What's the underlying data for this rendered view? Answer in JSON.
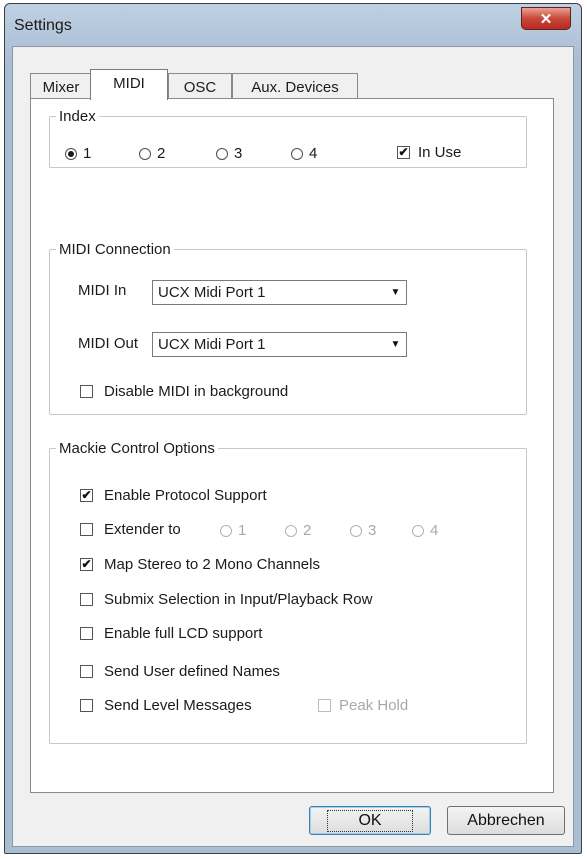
{
  "window": {
    "title": "Settings",
    "close_glyph": "✕"
  },
  "tabs": [
    {
      "label": "Mixer",
      "active": false
    },
    {
      "label": "MIDI",
      "active": true
    },
    {
      "label": "OSC",
      "active": false
    },
    {
      "label": "Aux. Devices",
      "active": false
    }
  ],
  "index": {
    "legend": "Index",
    "options": [
      "1",
      "2",
      "3",
      "4"
    ],
    "selected": "1",
    "in_use_label": "In Use",
    "in_use_checked": true
  },
  "midi_connection": {
    "legend": "MIDI Connection",
    "midi_in_label": "MIDI In",
    "midi_in_value": "UCX Midi Port 1",
    "midi_out_label": "MIDI Out",
    "midi_out_value": "UCX Midi Port 1",
    "disable_bg_label": "Disable MIDI in background",
    "disable_bg_checked": false
  },
  "mackie": {
    "legend": "Mackie Control Options",
    "enable_protocol_label": "Enable Protocol Support",
    "enable_protocol_checked": true,
    "extender_label": "Extender to",
    "extender_options": [
      "1",
      "2",
      "3",
      "4"
    ],
    "map_stereo_label": "Map Stereo to 2 Mono Channels",
    "map_stereo_checked": true,
    "submix_label": "Submix Selection in Input/Playback Row",
    "submix_checked": false,
    "lcd_label": "Enable full LCD support",
    "lcd_checked": false,
    "user_names_label": "Send User defined Names",
    "user_names_checked": false,
    "level_msgs_label": "Send Level Messages",
    "level_msgs_checked": false,
    "peak_hold_label": "Peak Hold",
    "peak_hold_checked": false
  },
  "buttons": {
    "ok_label": "OK",
    "cancel_label": "Abbrechen"
  },
  "icons": {
    "dropdown_arrow": "▼",
    "checkmark": "✔"
  }
}
